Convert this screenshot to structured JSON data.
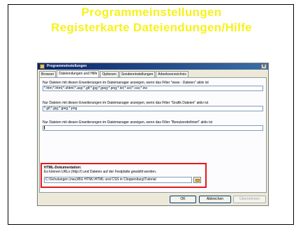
{
  "slide": {
    "title_line1": "Programmeinstellungen",
    "title_line2": "Registerkarte Dateiendungen/Hilfe",
    "title_color": "#f7f219"
  },
  "dialog": {
    "title": "Programmeinstellungen",
    "title_icon": "app-settings-icon",
    "close_label": "x",
    "tabs": [
      {
        "label": "Browser",
        "active": false
      },
      {
        "label": "Dateiendungen und Hilfe",
        "active": true
      },
      {
        "label": "Optionen",
        "active": false
      },
      {
        "label": "Sondereinstellungen",
        "active": false
      },
      {
        "label": "Arbeitsverzeichnis",
        "active": false
      }
    ],
    "sections": [
      {
        "label": "Nur Dateien mit diesen Erweiterungen im Dateimanager anzeigen, wenn das Filter \"www - Dateien\" aktiv ist",
        "value": "*.htm;*.html;*.shtml;*.asp;*.gif;*.jpg;*.jpeg;*.png;*.txt;*.xsl;*.css;*.inc"
      },
      {
        "label": "Nur Dateien mit diesen Erweiterungen im Dateimanager anzeigen, wenn das Filter \"Grafik Dateien\" aktiv ist",
        "value": "*.gif;*.jpg;*.jpeg;*.png"
      },
      {
        "label": "Nur Dateien mit diesen Erweiterungen im Dateimanager anzeigen, wenn das Filter \"Benutzerdefiniert\" aktiv ist",
        "value": ""
      }
    ],
    "html_doc": {
      "title": "HTML-Dokumentation:",
      "description": "Es können URLs (http://) und Dateien auf der Festplatte gewählt werden.",
      "path": "C:\\Schulungen (neu)\\BU HTML\\HTML und CSS in Cloppenburg\\Tutorial",
      "browse_icon": "folder-icon",
      "highlight_color": "#e2191c"
    },
    "buttons": {
      "ok": "OK",
      "cancel": "Abbrechen",
      "apply": "Übernehmen"
    }
  }
}
